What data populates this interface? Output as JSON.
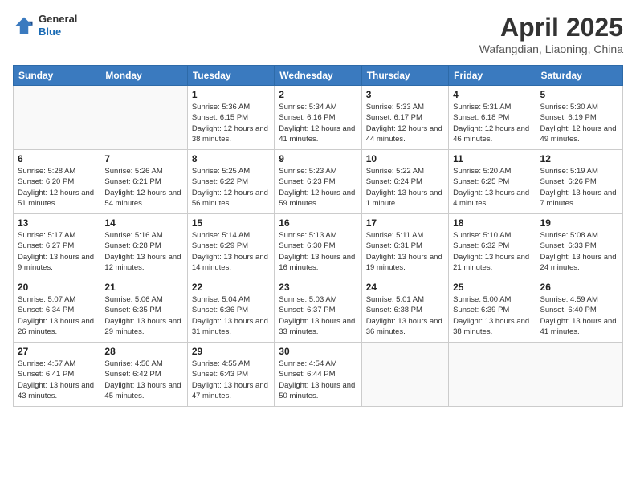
{
  "header": {
    "logo_general": "General",
    "logo_blue": "Blue",
    "month_title": "April 2025",
    "location": "Wafangdian, Liaoning, China"
  },
  "weekdays": [
    "Sunday",
    "Monday",
    "Tuesday",
    "Wednesday",
    "Thursday",
    "Friday",
    "Saturday"
  ],
  "weeks": [
    [
      {
        "day": "",
        "info": ""
      },
      {
        "day": "",
        "info": ""
      },
      {
        "day": "1",
        "info": "Sunrise: 5:36 AM\nSunset: 6:15 PM\nDaylight: 12 hours\nand 38 minutes."
      },
      {
        "day": "2",
        "info": "Sunrise: 5:34 AM\nSunset: 6:16 PM\nDaylight: 12 hours\nand 41 minutes."
      },
      {
        "day": "3",
        "info": "Sunrise: 5:33 AM\nSunset: 6:17 PM\nDaylight: 12 hours\nand 44 minutes."
      },
      {
        "day": "4",
        "info": "Sunrise: 5:31 AM\nSunset: 6:18 PM\nDaylight: 12 hours\nand 46 minutes."
      },
      {
        "day": "5",
        "info": "Sunrise: 5:30 AM\nSunset: 6:19 PM\nDaylight: 12 hours\nand 49 minutes."
      }
    ],
    [
      {
        "day": "6",
        "info": "Sunrise: 5:28 AM\nSunset: 6:20 PM\nDaylight: 12 hours\nand 51 minutes."
      },
      {
        "day": "7",
        "info": "Sunrise: 5:26 AM\nSunset: 6:21 PM\nDaylight: 12 hours\nand 54 minutes."
      },
      {
        "day": "8",
        "info": "Sunrise: 5:25 AM\nSunset: 6:22 PM\nDaylight: 12 hours\nand 56 minutes."
      },
      {
        "day": "9",
        "info": "Sunrise: 5:23 AM\nSunset: 6:23 PM\nDaylight: 12 hours\nand 59 minutes."
      },
      {
        "day": "10",
        "info": "Sunrise: 5:22 AM\nSunset: 6:24 PM\nDaylight: 13 hours\nand 1 minute."
      },
      {
        "day": "11",
        "info": "Sunrise: 5:20 AM\nSunset: 6:25 PM\nDaylight: 13 hours\nand 4 minutes."
      },
      {
        "day": "12",
        "info": "Sunrise: 5:19 AM\nSunset: 6:26 PM\nDaylight: 13 hours\nand 7 minutes."
      }
    ],
    [
      {
        "day": "13",
        "info": "Sunrise: 5:17 AM\nSunset: 6:27 PM\nDaylight: 13 hours\nand 9 minutes."
      },
      {
        "day": "14",
        "info": "Sunrise: 5:16 AM\nSunset: 6:28 PM\nDaylight: 13 hours\nand 12 minutes."
      },
      {
        "day": "15",
        "info": "Sunrise: 5:14 AM\nSunset: 6:29 PM\nDaylight: 13 hours\nand 14 minutes."
      },
      {
        "day": "16",
        "info": "Sunrise: 5:13 AM\nSunset: 6:30 PM\nDaylight: 13 hours\nand 16 minutes."
      },
      {
        "day": "17",
        "info": "Sunrise: 5:11 AM\nSunset: 6:31 PM\nDaylight: 13 hours\nand 19 minutes."
      },
      {
        "day": "18",
        "info": "Sunrise: 5:10 AM\nSunset: 6:32 PM\nDaylight: 13 hours\nand 21 minutes."
      },
      {
        "day": "19",
        "info": "Sunrise: 5:08 AM\nSunset: 6:33 PM\nDaylight: 13 hours\nand 24 minutes."
      }
    ],
    [
      {
        "day": "20",
        "info": "Sunrise: 5:07 AM\nSunset: 6:34 PM\nDaylight: 13 hours\nand 26 minutes."
      },
      {
        "day": "21",
        "info": "Sunrise: 5:06 AM\nSunset: 6:35 PM\nDaylight: 13 hours\nand 29 minutes."
      },
      {
        "day": "22",
        "info": "Sunrise: 5:04 AM\nSunset: 6:36 PM\nDaylight: 13 hours\nand 31 minutes."
      },
      {
        "day": "23",
        "info": "Sunrise: 5:03 AM\nSunset: 6:37 PM\nDaylight: 13 hours\nand 33 minutes."
      },
      {
        "day": "24",
        "info": "Sunrise: 5:01 AM\nSunset: 6:38 PM\nDaylight: 13 hours\nand 36 minutes."
      },
      {
        "day": "25",
        "info": "Sunrise: 5:00 AM\nSunset: 6:39 PM\nDaylight: 13 hours\nand 38 minutes."
      },
      {
        "day": "26",
        "info": "Sunrise: 4:59 AM\nSunset: 6:40 PM\nDaylight: 13 hours\nand 41 minutes."
      }
    ],
    [
      {
        "day": "27",
        "info": "Sunrise: 4:57 AM\nSunset: 6:41 PM\nDaylight: 13 hours\nand 43 minutes."
      },
      {
        "day": "28",
        "info": "Sunrise: 4:56 AM\nSunset: 6:42 PM\nDaylight: 13 hours\nand 45 minutes."
      },
      {
        "day": "29",
        "info": "Sunrise: 4:55 AM\nSunset: 6:43 PM\nDaylight: 13 hours\nand 47 minutes."
      },
      {
        "day": "30",
        "info": "Sunrise: 4:54 AM\nSunset: 6:44 PM\nDaylight: 13 hours\nand 50 minutes."
      },
      {
        "day": "",
        "info": ""
      },
      {
        "day": "",
        "info": ""
      },
      {
        "day": "",
        "info": ""
      }
    ]
  ]
}
